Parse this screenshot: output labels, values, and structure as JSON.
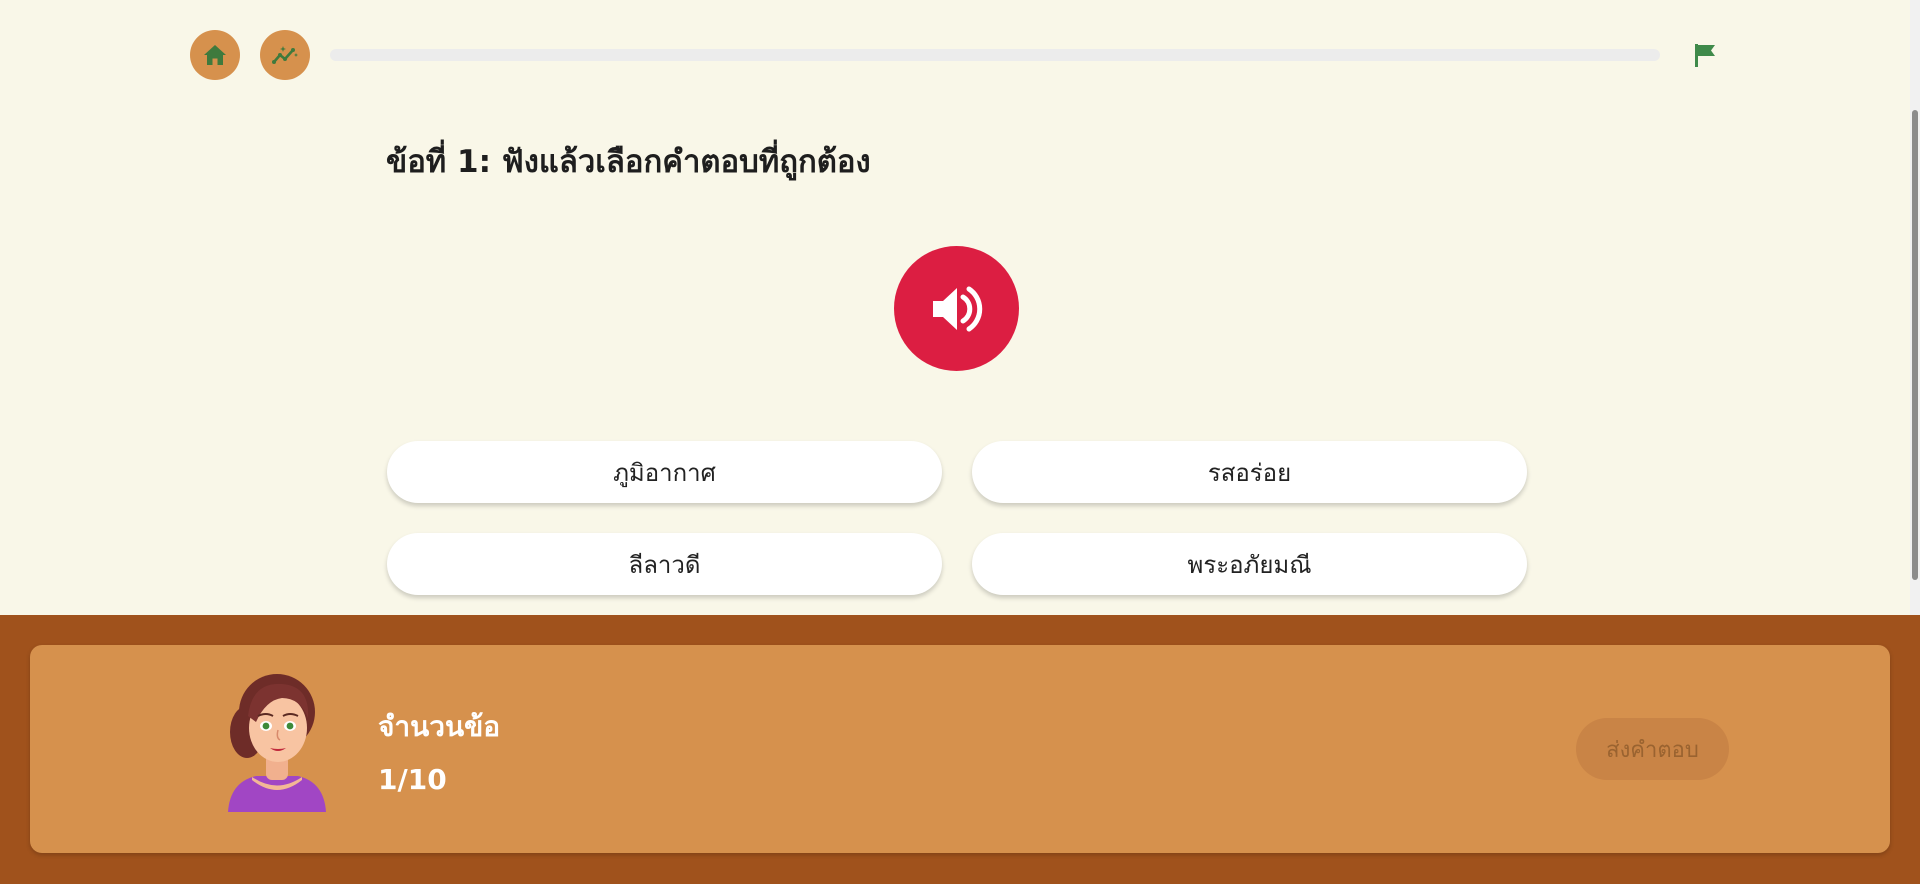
{
  "topbar": {
    "home_icon": "home-icon",
    "stats_icon": "chart-sparkle-icon",
    "flag_icon": "flag-icon",
    "progress": 0,
    "accent_color": "#4e8a4a"
  },
  "question": {
    "title": "ข้อที่ 1: ฟังแล้วเลือกคำตอบที่ถูกต้อง",
    "audio_icon": "speaker-icon",
    "audio_color": "#dc1e42",
    "options": [
      "ภูมิอากาศ",
      "รสอร่อย",
      "ลีลาวดี",
      "พระอภัยมณี"
    ]
  },
  "footer": {
    "count_label": "จำนวนข้อ",
    "count_value": "1/10",
    "submit_label": "ส่งคำตอบ",
    "submit_enabled": false,
    "background_color": "#a0521c",
    "card_color": "#d6914d"
  }
}
